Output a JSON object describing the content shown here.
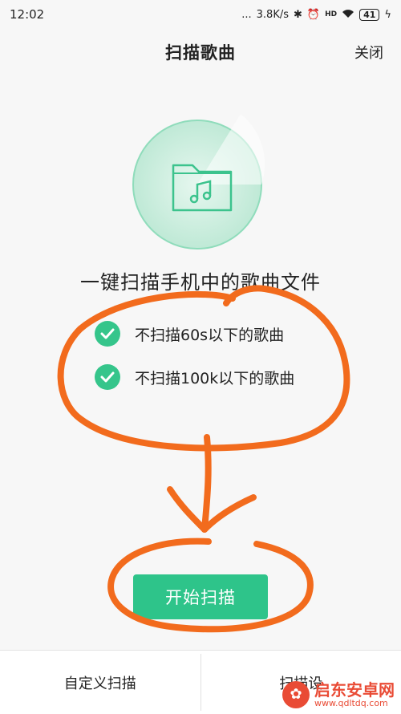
{
  "status_bar": {
    "time": "12:02",
    "signal": "...",
    "speed": "3.8K/s",
    "hd_label": "HD",
    "battery": "41"
  },
  "header": {
    "title": "扫描歌曲",
    "close_label": "关闭"
  },
  "main": {
    "headline": "一键扫描手机中的歌曲文件",
    "options": [
      {
        "label": "不扫描60s以下的歌曲",
        "checked": true
      },
      {
        "label": "不扫描100k以下的歌曲",
        "checked": true
      }
    ],
    "start_label": "开始扫描"
  },
  "bottom_bar": {
    "left_label": "自定义扫描",
    "right_label": "扫描设"
  },
  "watermark": {
    "name": "启东安卓网",
    "url": "www.qdltdq.com"
  },
  "colors": {
    "accent": "#2ec48a",
    "annotation": "#f26b1d"
  }
}
